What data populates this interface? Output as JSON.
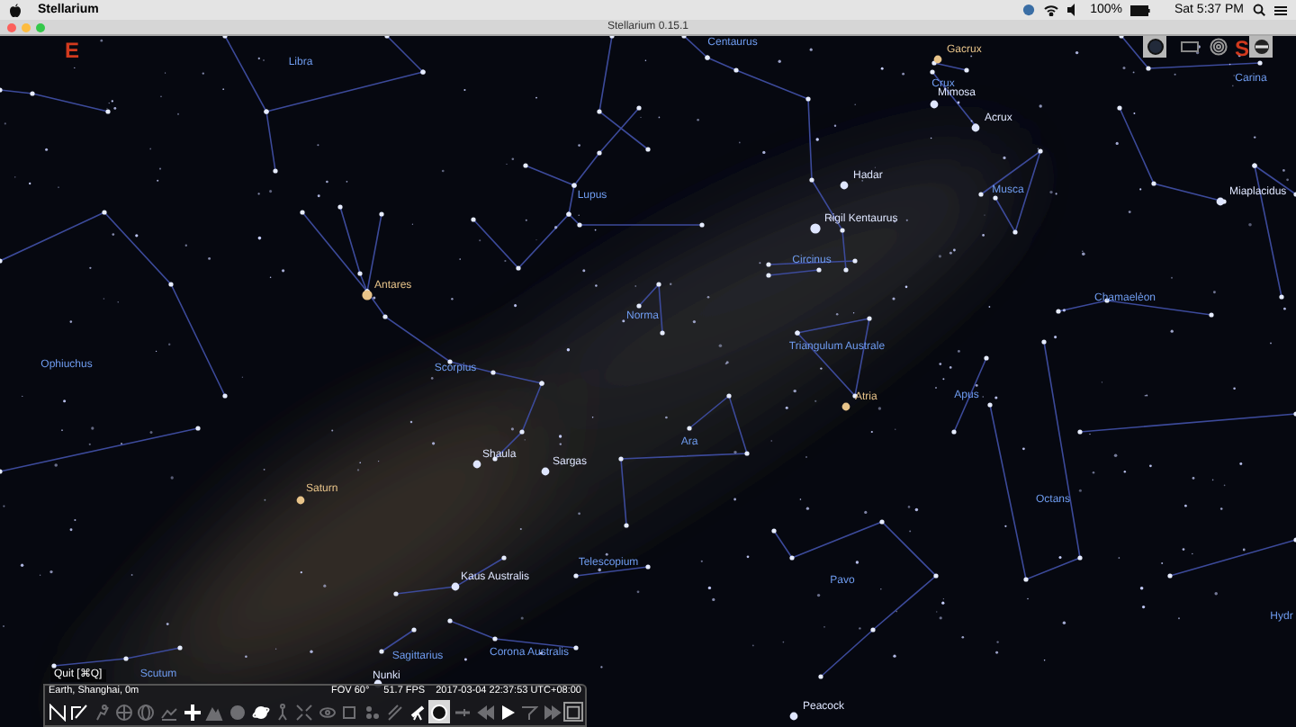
{
  "menu_bar": {
    "app_name": "Stellarium",
    "battery": "100%",
    "clock": "Sat 5:37 PM"
  },
  "window": {
    "title": "Stellarium 0.15.1"
  },
  "compass": [
    "E",
    "S"
  ],
  "constellations": [
    "Libra",
    "Centaurus",
    "Crux",
    "Carina",
    "Lupus",
    "Musca",
    "Circinus",
    "Chamaeleon",
    "Norma",
    "Ophiuchus",
    "Scorpius",
    "Triangulum Australe",
    "Ara",
    "Apus",
    "Octans",
    "Telescopium",
    "Pavo",
    "Corona Australis",
    "Sagittarius",
    "Scutum",
    "Hydr"
  ],
  "stars": [
    {
      "name": "Gacrux",
      "color": "#e8c48a"
    },
    {
      "name": "Mimosa",
      "color": "#dfe6ff"
    },
    {
      "name": "Acrux",
      "color": "#dfe6ff"
    },
    {
      "name": "Hadar",
      "color": "#dfe6ff"
    },
    {
      "name": "Rigil Kentaurus",
      "color": "#dfe6ff"
    },
    {
      "name": "Miaplacidus",
      "color": "#dfe6ff"
    },
    {
      "name": "Antares",
      "color": "#e8c48a"
    },
    {
      "name": "Atria",
      "color": "#e8c48a"
    },
    {
      "name": "Shaula",
      "color": "#dfe6ff"
    },
    {
      "name": "Sargas",
      "color": "#dfe6ff"
    },
    {
      "name": "Kaus Australis",
      "color": "#dfe6ff"
    },
    {
      "name": "Saturn",
      "color": "#e8c48a"
    },
    {
      "name": "Nunki",
      "color": "#dfe6ff"
    },
    {
      "name": "Peacock",
      "color": "#dfe6ff"
    }
  ],
  "tooltip": "Quit [⌘Q]",
  "info_bar": {
    "location": "Earth, Shanghai, 0m",
    "fov": "FOV 60°",
    "fps": "51.7 FPS",
    "datetime": "2017-03-04 22:37:53 UTC+08:00"
  },
  "toolbar": [
    {
      "selected": true
    },
    {
      "selected": true
    },
    {
      "selected": false
    },
    {
      "selected": false
    },
    {
      "selected": false
    },
    {
      "selected": false
    },
    {
      "selected": true
    },
    {
      "selected": false
    },
    {
      "selected": false
    },
    {
      "selected": true
    },
    {
      "selected": false
    },
    {
      "selected": false
    },
    {
      "selected": false
    },
    {
      "selected": false
    },
    {
      "selected": false
    },
    {
      "selected": false
    },
    {
      "selected": true
    },
    {
      "selected": true
    },
    {
      "selected": false
    },
    {
      "selected": false
    },
    {
      "selected": true
    },
    {
      "selected": false
    },
    {
      "selected": false
    }
  ],
  "top_right_toolbar": [
    {
      "selected": true
    },
    {
      "selected": false
    },
    {
      "selected": false
    },
    {
      "selected": true
    }
  ]
}
